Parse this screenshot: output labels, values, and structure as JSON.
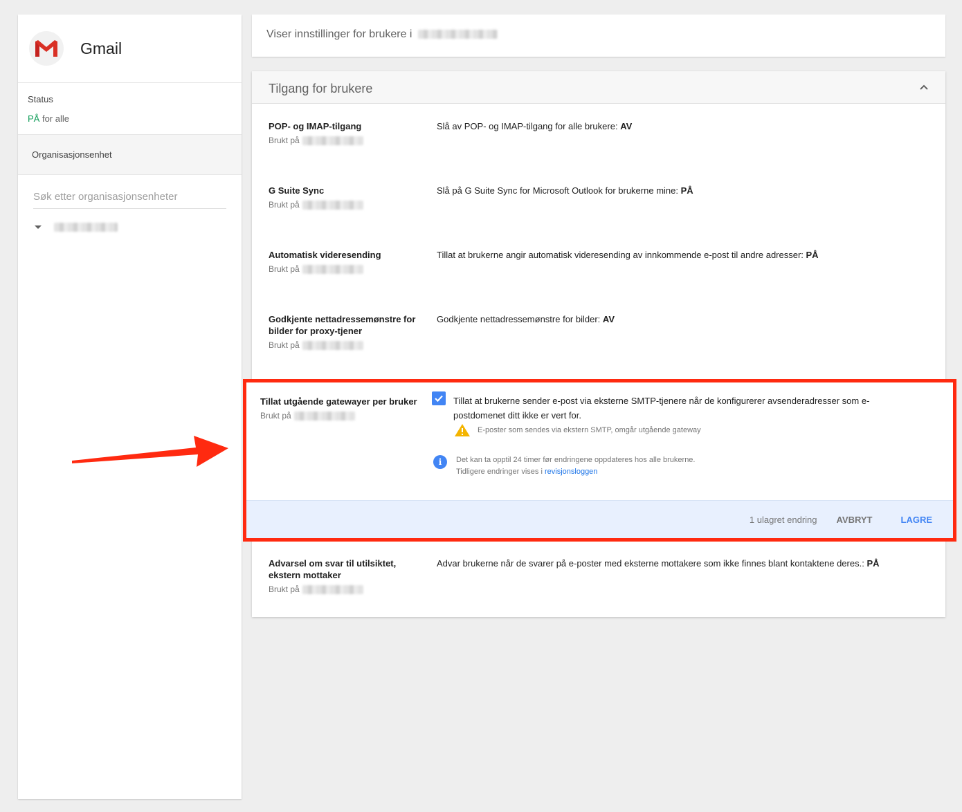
{
  "left": {
    "app_title": "Gmail",
    "status_label": "Status",
    "status_on": "PÅ",
    "status_rest": " for alle",
    "org_unit_title": "Organisasjonsenhet",
    "org_search_placeholder": "Søk etter organisasjonsenheter"
  },
  "top_bar": {
    "text": "Viser innstillinger for brukere i"
  },
  "card": {
    "title": "Tilgang for brukere",
    "applied_label": "Brukt på",
    "rows": [
      {
        "title": "POP- og IMAP-tilgang",
        "desc": "Slå av POP- og IMAP-tilgang for alle brukere: ",
        "value": "AV"
      },
      {
        "title": "G Suite Sync",
        "desc": "Slå på G Suite Sync for Microsoft Outlook for brukerne mine: ",
        "value": "PÅ"
      },
      {
        "title": "Automatisk videresending",
        "desc": "Tillat at brukerne angir automatisk videresending av innkommende e-post til andre adresser: ",
        "value": "PÅ"
      },
      {
        "title": "Godkjente nettadressemønstre for bilder for proxy-tjener",
        "desc": "Godkjente nettadressemønstre for bilder: ",
        "value": "AV"
      },
      {
        "title": "Advarsel om svar til utilsiktet, ekstern mottaker",
        "desc": "Advar brukerne når de svarer på e-poster med eksterne mottakere som ikke finnes blant kontaktene deres.: ",
        "value": "PÅ"
      }
    ]
  },
  "highlight": {
    "title": "Tillat utgående gatewayer per bruker",
    "applied_label": "Brukt på",
    "checkbox_label": "Tillat at brukerne sender e-post via eksterne SMTP-tjenere når de konfigurerer avsenderadresser som e-postdomenet ditt ikke er vert for.",
    "warning": "E-poster som sendes via ekstern SMTP, omgår utgående gateway",
    "info_line1": "Det kan ta opptil 24 timer før endringene oppdateres hos alle brukerne.",
    "info_line2": "Tidligere endringer vises i ",
    "info_link": "revisjonsloggen",
    "unsaved": "1 ulagret endring",
    "cancel": "AVBRYT",
    "save": "LAGRE"
  },
  "colors": {
    "accent": "#4285f4",
    "on_status": "#0f9d58",
    "highlight_border": "#ff2a10",
    "footer_bg": "#e8f0fe"
  },
  "icons": [
    "gmail-logo-icon",
    "chevron-up-icon",
    "caret-down-icon",
    "checkbox-checked-icon",
    "warning-icon",
    "info-icon",
    "arrow-annotation-icon"
  ]
}
